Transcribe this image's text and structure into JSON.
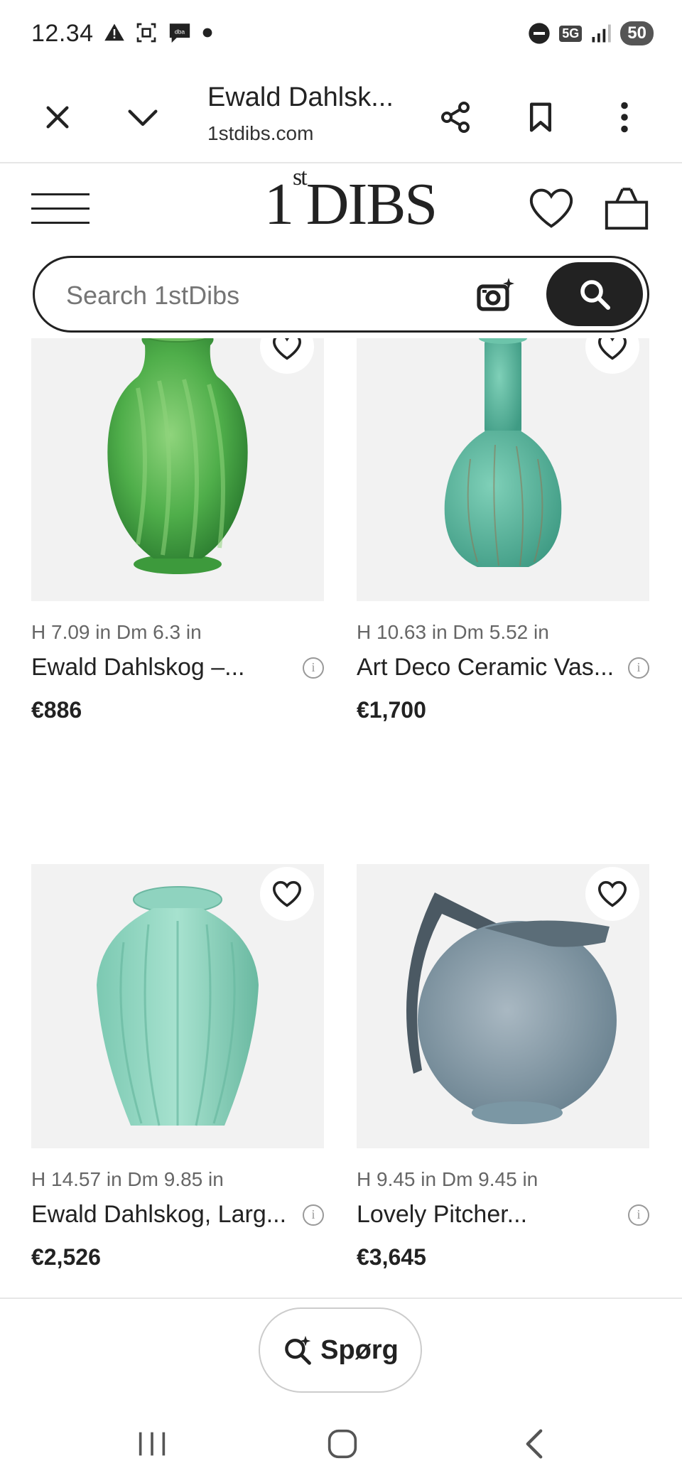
{
  "status_bar": {
    "time": "12.34",
    "network": "5G",
    "battery": "50"
  },
  "browser": {
    "title": "Ewald Dahlsk...",
    "url": "1stdibs.com"
  },
  "site": {
    "logo_number": "1",
    "logo_sup": "st",
    "logo_text": "DIBS"
  },
  "search": {
    "placeholder": "Search 1stDibs"
  },
  "products": [
    {
      "dims": "H 7.09 in Dm 6.3 in",
      "name": "Ewald Dahlskog –...",
      "price": "€886"
    },
    {
      "dims": "H 10.63 in Dm 5.52 in",
      "name": "Art Deco Ceramic Vas...",
      "price": "€1,700"
    },
    {
      "dims": "H 14.57 in Dm 9.85 in",
      "name": "Ewald Dahlskog, Larg...",
      "price": "€2,526"
    },
    {
      "dims": "H 9.45 in Dm 9.45 in",
      "name": "Lovely Pitcher...",
      "price": "€3,645"
    }
  ],
  "ask": {
    "label": "Spørg"
  },
  "colors": {
    "accent": "#222222",
    "card_bg": "#f2f2f2",
    "vase_green": "#4fae4a",
    "vase_turquoise": "#5fb8a0",
    "vase_mint": "#8fd3bf",
    "pitcher_grey": "#8096a3"
  }
}
